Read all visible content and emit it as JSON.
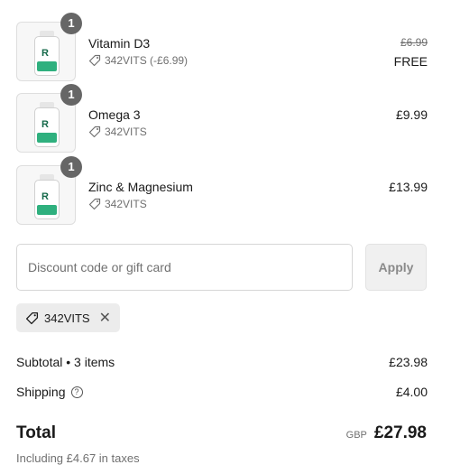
{
  "items": [
    {
      "name": "Vitamin D3",
      "quantity": "1",
      "discount_text": "342VITS (-£6.99)",
      "price_original": "£6.99",
      "price_final": "FREE"
    },
    {
      "name": "Omega 3",
      "quantity": "1",
      "discount_text": "342VITS",
      "price_final": "£9.99"
    },
    {
      "name": "Zinc & Magnesium",
      "quantity": "1",
      "discount_text": "342VITS",
      "price_final": "£13.99"
    }
  ],
  "discount": {
    "placeholder": "Discount code or gift card",
    "apply_label": "Apply",
    "applied_code": "342VITS",
    "remove_symbol": "✕"
  },
  "summary": {
    "subtotal_label": "Subtotal • 3 items",
    "subtotal_value": "£23.98",
    "shipping_label": "Shipping",
    "shipping_value": "£4.00",
    "total_label": "Total",
    "currency": "GBP",
    "total_value": "£27.98",
    "taxes_text": "Including £4.67 in taxes"
  },
  "colors": {
    "accent_green": "#2fb07e",
    "badge": "#666666"
  }
}
